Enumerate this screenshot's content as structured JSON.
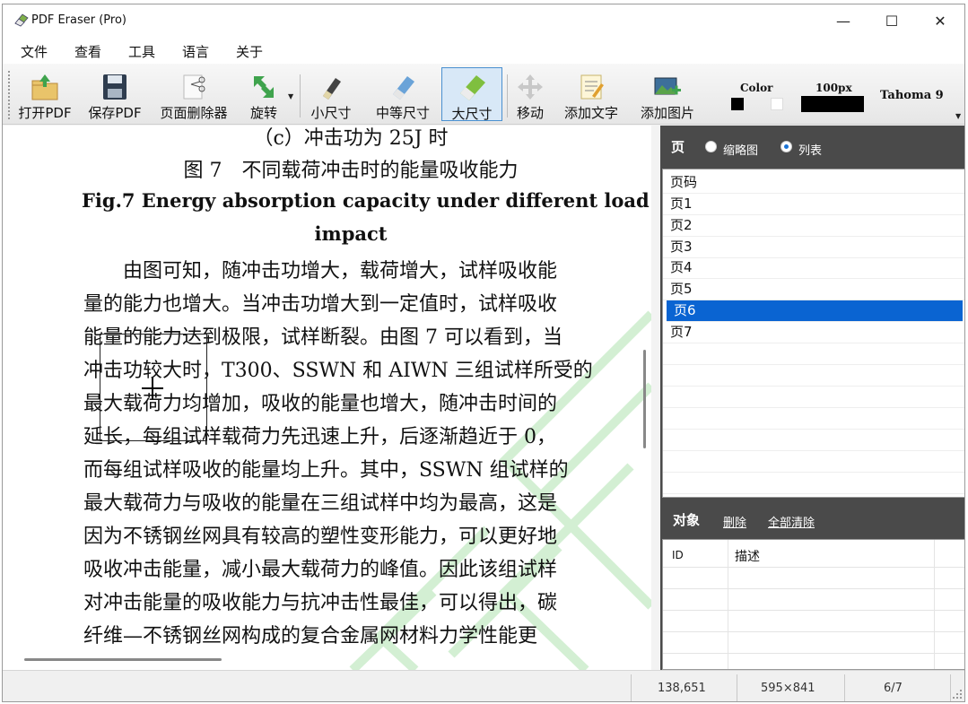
{
  "window": {
    "title": "PDF Eraser (Pro)",
    "min_glyph": "—",
    "max_glyph": "☐",
    "close_glyph": "✕"
  },
  "menu": [
    "文件",
    "查看",
    "工具",
    "语言",
    "关于"
  ],
  "toolbar": {
    "open": "打开PDF",
    "save": "保存PDF",
    "page_remover": "页面删除器",
    "rotate": "旋转",
    "small": "小尺寸",
    "medium": "中等尺寸",
    "large": "大尺寸",
    "move": "移动",
    "add_text": "添加文字",
    "add_image": "添加图片",
    "color_label": "Color",
    "size_label": "100px",
    "font_label": "Tahoma 9"
  },
  "document": {
    "lines": [
      "（c）冲击功为 25J 时",
      "图 7　不同载荷冲击时的能量吸收能力",
      "Fig.7 Energy absorption capacity under different load",
      "impact",
      "　　由图可知，随冲击功增大，载荷增大，试样吸收能",
      "量的能力也增大。当冲击功增大到一定值时，试样吸收",
      "能量的能力达到极限，试样断裂。由图 7 可以看到，当",
      "冲击功较大时，T300、SSWN 和 AIWN 三组试样所受的",
      "最大载荷力均增加，吸收的能量也增大，随冲击时间的",
      "延长，每组试样载荷力先迅速上升，后逐渐趋近于 0，",
      "而每组试样吸收的能量均上升。其中，SSWN 组试样的",
      "最大载荷力与吸收的能量在三组试样中均为最高，这是",
      "因为不锈钢丝网具有较高的塑性变形能力，可以更好地",
      "吸收冲击能量，减小最大载荷力的峰值。因此该组试样",
      "对冲击能量的吸收能力与抗冲击性最佳，可以得出，碳",
      "纤维—不锈钢丝网构成的复合金属网材料力学性能更"
    ]
  },
  "pages_panel": {
    "title": "页",
    "thumbnail_label": "缩略图",
    "list_label": "列表",
    "view_mode": "list",
    "header": "页码",
    "items": [
      "页1",
      "页2",
      "页3",
      "页4",
      "页5",
      "页6",
      "页7"
    ],
    "selected_index": 5
  },
  "objects_panel": {
    "title": "对象",
    "delete_label": "删除",
    "clear_all_label": "全部清除",
    "col_id": "ID",
    "col_desc": "描述"
  },
  "status": {
    "coords": "138,651",
    "page_size": "595×841",
    "page_of": "6/7"
  },
  "colors": {
    "selection": "#0a64d2",
    "panel_bg": "#4a4a4a",
    "watermark": "#d6f0d6"
  }
}
